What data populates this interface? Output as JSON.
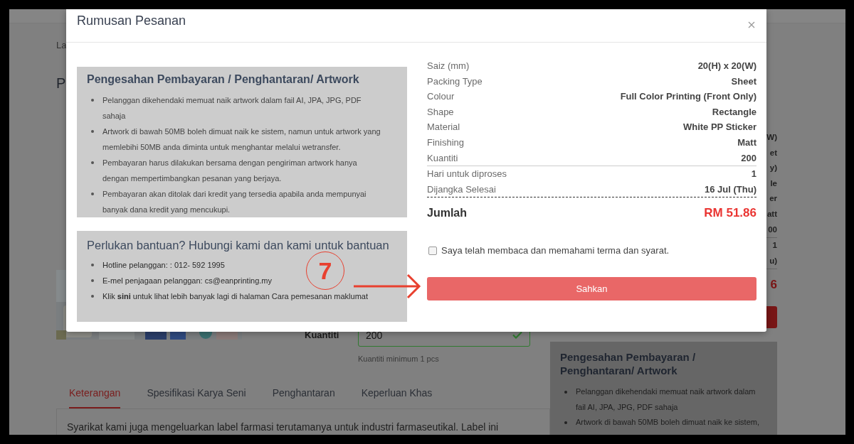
{
  "page": {
    "breadcrumb": "La",
    "title": "P",
    "quantity": {
      "label": "Kuantiti",
      "value": "200",
      "valid": true,
      "hint": "Kuantiti minimum 1 pcs"
    },
    "tabs": [
      {
        "label": "Keterangan",
        "selected": true
      },
      {
        "label": "Spesifikasi Karya Seni",
        "selected": false
      },
      {
        "label": "Penghantaran",
        "selected": false
      },
      {
        "label": "Keperluan Khas",
        "selected": false
      }
    ],
    "description": "Syarikat kami juga mengeluarkan label farmasi terutamanya untuk industri farmaseutikal. Label ini",
    "summary_fragments": [
      {
        "items": [
          "W)",
          "et",
          "y)",
          "le",
          "er",
          "att",
          "00"
        ]
      },
      {
        "items": [
          "1",
          "u)"
        ]
      }
    ],
    "total_fragment": "6",
    "side_panel": {
      "title": "Pengesahan Pembayaran / Penghantaran/ Artwork",
      "items": [
        "Pelanggan dikehendaki memuat naik artwork dalam fail AI, JPA, JPG, PDF sahaja",
        "Artwork di bawah 50MB boleh dimuat naik ke sistem,"
      ]
    }
  },
  "modal": {
    "title": "Rumusan Pesanan",
    "payment_panel": {
      "title": "Pengesahan Pembayaran / Penghantaran/ Artwork",
      "items": [
        "Pelanggan dikehendaki memuat naik artwork dalam fail AI, JPA, JPG, PDF sahaja",
        "Artwork di bawah 50MB boleh dimuat naik ke sistem, namun untuk artwork yang memlebihi 50MB anda diminta untuk menghantar melalui wetransfer.",
        "Pembayaran harus dilakukan bersama dengan pengiriman artwork hanya dengan mempertimbangkan pesanan yang berjaya.",
        "Pembayaran akan ditolak dari kredit yang tersedia apabila anda mempunyai banyak dana kredit yang mencukupi."
      ]
    },
    "help_panel": {
      "title": "Perlukan bantuan? Hubungi kami dan kami untuk bantuan",
      "items": [
        "Hotline pelanggan: : 012- 592 1995",
        "E-mel penjagaan pelanggan: cs@eanprinting.my",
        "Klik **sini** untuk lihat lebih banyak lagi di halaman Cara pemesanan maklumat"
      ]
    },
    "summary_groups": [
      {
        "rows": [
          {
            "label": "Saiz (mm)",
            "value": "20(H) x 20(W)"
          },
          {
            "label": "Packing Type",
            "value": "Sheet"
          },
          {
            "label": "Colour",
            "value": "Full Color Printing (Front Only)"
          },
          {
            "label": "Shape",
            "value": "Rectangle"
          },
          {
            "label": "Material",
            "value": "White PP Sticker"
          },
          {
            "label": "Finishing",
            "value": "Matt"
          },
          {
            "label": "Kuantiti",
            "value": "200"
          }
        ]
      },
      {
        "rows": [
          {
            "label": "Hari untuk diproses",
            "value": "1"
          },
          {
            "label": "Dijangka Selesai",
            "value": "16 Jul (Thu)"
          }
        ]
      }
    ],
    "total": {
      "label": "Jumlah",
      "value": "RM 51.86"
    },
    "terms": {
      "label": "Saya telah membaca dan memahami terma dan syarat.",
      "checked": false
    },
    "confirm_button": "Sahkan"
  },
  "annotation": {
    "number": "7"
  }
}
